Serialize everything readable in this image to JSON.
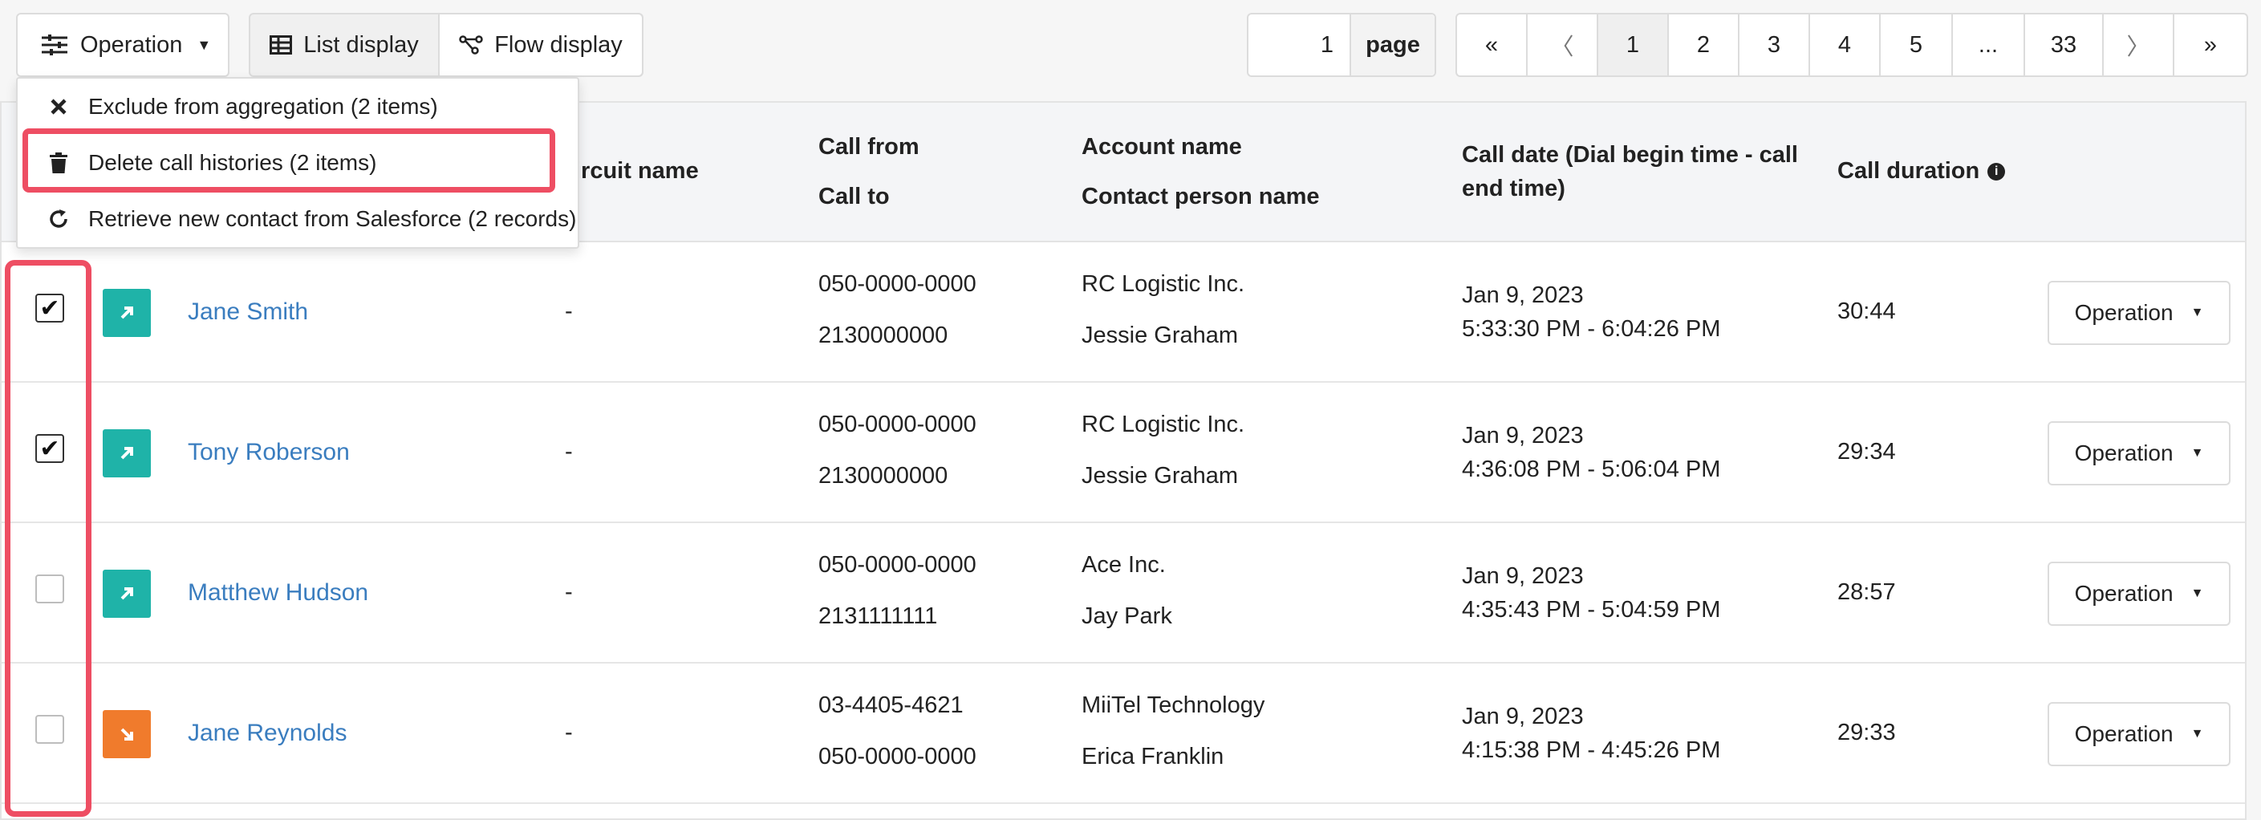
{
  "toolbar": {
    "operation_label": "Operation",
    "list_display_label": "List display",
    "flow_display_label": "Flow display",
    "page_input_value": "1",
    "page_word": "page",
    "pager": [
      "«",
      "〈",
      "1",
      "2",
      "3",
      "4",
      "5",
      "...",
      "33",
      "〉",
      "»"
    ],
    "current_page": "1"
  },
  "dropdown": {
    "items": [
      {
        "icon": "close-icon",
        "label": "Exclude from aggregation (2 items)"
      },
      {
        "icon": "trash-icon",
        "label": "Delete call histories (2 items)"
      },
      {
        "icon": "refresh-icon",
        "label": "Retrieve new contact from Salesforce (2 records)"
      }
    ]
  },
  "table": {
    "headers": {
      "circuit_name": "ircuit name",
      "call_from": "Call from",
      "call_to": "Call to",
      "account_name": "Account name",
      "contact_person": "Contact person name",
      "call_date": "Call date (Dial begin time - call end time)",
      "call_duration": "Call duration"
    },
    "rows": [
      {
        "checked": true,
        "direction": "outgoing",
        "name": "Jane Smith",
        "circuit": "-",
        "call_from": "050-0000-0000",
        "call_to": "2130000000",
        "account": "RC Logistic Inc.",
        "contact": "Jessie Graham",
        "date": "Jan 9, 2023",
        "time": "5:33:30 PM - 6:04:26 PM",
        "duration": "30:44",
        "op_label": "Operation"
      },
      {
        "checked": true,
        "direction": "outgoing",
        "name": "Tony Roberson",
        "circuit": "-",
        "call_from": "050-0000-0000",
        "call_to": "2130000000",
        "account": "RC Logistic Inc.",
        "contact": "Jessie Graham",
        "date": "Jan 9, 2023",
        "time": "4:36:08 PM - 5:06:04 PM",
        "duration": "29:34",
        "op_label": "Operation"
      },
      {
        "checked": false,
        "direction": "outgoing",
        "name": "Matthew Hudson",
        "circuit": "-",
        "call_from": "050-0000-0000",
        "call_to": "2131111111",
        "account": "Ace Inc.",
        "contact": "Jay Park",
        "date": "Jan 9, 2023",
        "time": "4:35:43 PM - 5:04:59 PM",
        "duration": "28:57",
        "op_label": "Operation"
      },
      {
        "checked": false,
        "direction": "incoming",
        "name": "Jane Reynolds",
        "circuit": "-",
        "call_from": "03-4405-4621",
        "call_to": "050-0000-0000",
        "account": "MiiTel Technology",
        "contact": "Erica Franklin",
        "date": "Jan 9, 2023",
        "time": "4:15:38 PM - 4:45:26 PM",
        "duration": "29:33",
        "op_label": "Operation"
      }
    ]
  },
  "colors": {
    "highlight": "#ee4e63",
    "outgoing": "#1fb3a8",
    "incoming": "#f07b2c",
    "link": "#3a7dbf"
  }
}
